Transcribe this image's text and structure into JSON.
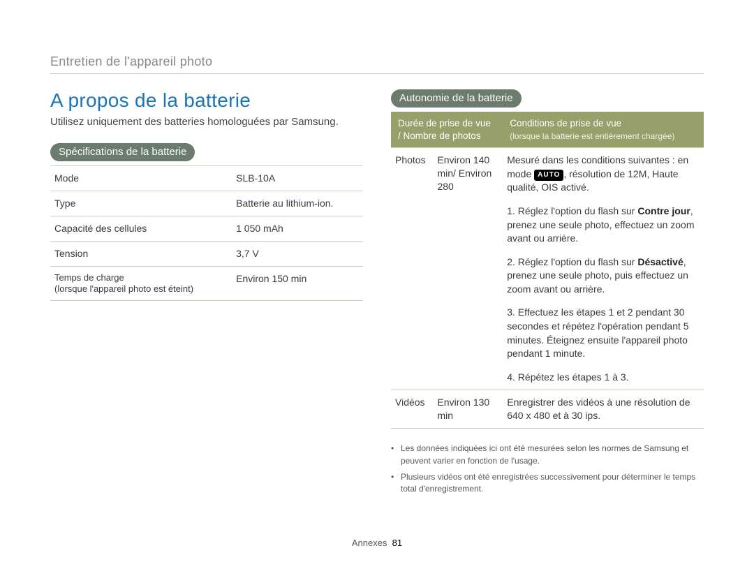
{
  "top_section": "Entretien de l'appareil photo",
  "heading": "A propos de la batterie",
  "intro": "Utilisez uniquement des batteries homologuées par Samsung.",
  "spec_title": "Spécifications de la batterie",
  "spec_rows": [
    {
      "k": "Mode",
      "v": "SLB-10A"
    },
    {
      "k": "Type",
      "v": "Batterie au lithium-ion."
    },
    {
      "k": "Capacité des cellules",
      "v": "1 050 mAh"
    },
    {
      "k": "Tension",
      "v": "3,7 V"
    }
  ],
  "spec_last": {
    "k1": "Temps de charge",
    "k2": "(lorsque l'appareil photo est éteint)",
    "v": "Environ 150 min"
  },
  "aut_title": "Autonomie de la batterie",
  "aut_head": {
    "left": "Durée de prise de vue / Nombre de photos",
    "right": "Conditions de prise de vue",
    "right_sub": "(lorsque la batterie est entièrement chargée)"
  },
  "photos_label": "Photos",
  "photos_value": "Environ 140 min/ Environ 280",
  "photos_cond": {
    "intro_a": "Mesuré dans les conditions suivantes : en mode ",
    "badge": "AUTO",
    "intro_b": ", résolution de 12M, Haute qualité, OIS activé.",
    "s1a": "1. Réglez l'option du flash sur ",
    "s1b": "Contre jour",
    "s1c": ", prenez une seule photo, effectuez un zoom avant ou arrière.",
    "s2a": "2. Réglez l'option du flash sur ",
    "s2b": "Désactivé",
    "s2c": ", prenez une seule photo, puis effectuez un zoom avant ou arrière.",
    "s3": "3. Effectuez les étapes 1 et 2 pendant 30 secondes et répétez l'opération pendant 5 minutes. Éteignez ensuite l'appareil photo pendant 1 minute.",
    "s4": "4. Répétez les étapes 1 à 3."
  },
  "videos_label": "Vidéos",
  "videos_value": "Environ 130 min",
  "videos_cond": "Enregistrer des vidéos à une résolution de 640 x 480 et à 30 ips.",
  "notes": [
    "Les données indiquées ici ont été mesurées selon les normes de Samsung et peuvent varier en fonction de l'usage.",
    "Plusieurs vidéos ont été enregistrées successivement pour déterminer le temps total d'enregistrement."
  ],
  "footer_label": "Annexes",
  "footer_page": "81"
}
